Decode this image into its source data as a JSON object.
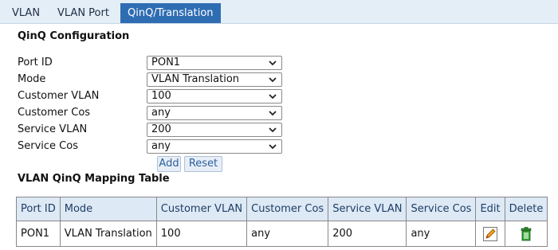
{
  "tabs": [
    {
      "label": "VLAN"
    },
    {
      "label": "VLAN Port"
    },
    {
      "label": "QinQ/Translation"
    }
  ],
  "qinq": {
    "title": "QinQ Configuration",
    "fields": [
      {
        "label": "Port ID",
        "value": "PON1"
      },
      {
        "label": "Mode",
        "value": "VLAN Translation"
      },
      {
        "label": "Customer VLAN",
        "value": "100"
      },
      {
        "label": "Customer Cos",
        "value": "any"
      },
      {
        "label": "Service VLAN",
        "value": "200"
      },
      {
        "label": "Service Cos",
        "value": "any"
      }
    ],
    "add_label": "Add",
    "reset_label": "Reset"
  },
  "mapping": {
    "title": "VLAN QinQ Mapping Table",
    "headers": [
      "Port ID",
      "Mode",
      "Customer VLAN",
      "Customer Cos",
      "Service VLAN",
      "Service Cos",
      "Edit",
      "Delete"
    ],
    "rows": [
      {
        "port_id": "PON1",
        "mode": "VLAN Translation",
        "customer_vlan": "100",
        "customer_cos": "any",
        "service_vlan": "200",
        "service_cos": "any",
        "edit_icon": "edit-icon",
        "delete_icon": "trash-icon"
      }
    ]
  },
  "colors": {
    "active_tab": "#2f6db3",
    "tab_bar": "#e4eef7",
    "table_header": "#dde9f5",
    "button_bg": "#e8eef7",
    "button_text": "#2b5f9e"
  }
}
